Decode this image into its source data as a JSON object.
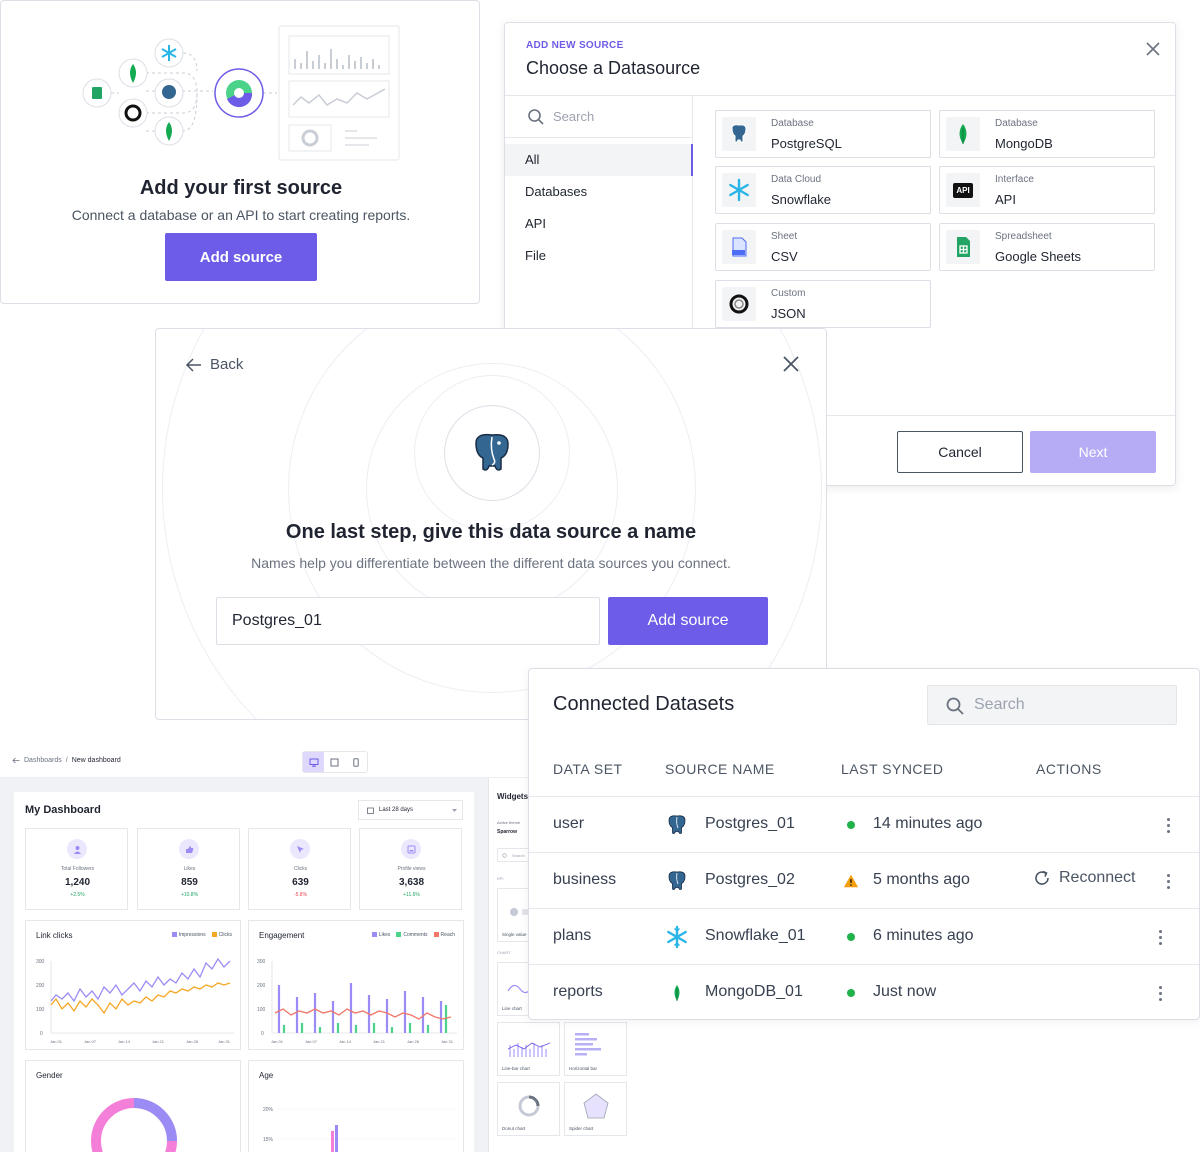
{
  "first_source": {
    "title": "Add your first source",
    "subtitle": "Connect a database or an API to start creating reports.",
    "button": "Add source"
  },
  "choose": {
    "eyebrow": "ADD NEW SOURCE",
    "title": "Choose a Datasource",
    "search_placeholder": "Search",
    "categories": [
      {
        "label": "All",
        "active": true
      },
      {
        "label": "Databases",
        "active": false
      },
      {
        "label": "API",
        "active": false
      },
      {
        "label": "File",
        "active": false
      }
    ],
    "sources": [
      {
        "kind": "Database",
        "name": "PostgreSQL",
        "icon": "postgres-icon"
      },
      {
        "kind": "Database",
        "name": "MongoDB",
        "icon": "mongodb-icon"
      },
      {
        "kind": "Data Cloud",
        "name": "Snowflake",
        "icon": "snowflake-icon"
      },
      {
        "kind": "Interface",
        "name": "API",
        "icon": "api-icon"
      },
      {
        "kind": "Sheet",
        "name": "CSV",
        "icon": "csv-icon"
      },
      {
        "kind": "Spreadsheet",
        "name": "Google Sheets",
        "icon": "google-sheets-icon"
      },
      {
        "kind": "Custom",
        "name": "JSON",
        "icon": "json-icon"
      }
    ],
    "api_badge": "API",
    "cancel": "Cancel",
    "next": "Next"
  },
  "name_step": {
    "back": "Back",
    "title": "One last step, give this data source a name",
    "subtitle": "Names help you differentiate between the different data sources you connect.",
    "input_value": "Postgres_01",
    "button": "Add source"
  },
  "dashboard": {
    "breadcrumb_root": "Dashboards",
    "breadcrumb_current": "New dashboard",
    "title": "My Dashboard",
    "date_range": "Last 28 days",
    "kpis": [
      {
        "label": "Total Followers",
        "value": "1,240",
        "delta": "+2.5%",
        "up": true
      },
      {
        "label": "Likes",
        "value": "859",
        "delta": "+10.8%",
        "up": true
      },
      {
        "label": "Clicks",
        "value": "639",
        "delta": "-5.8%",
        "up": false
      },
      {
        "label": "Profile views",
        "value": "3,638",
        "delta": "+11.6%",
        "up": true
      }
    ],
    "link_clicks": {
      "title": "Link clicks",
      "legend": [
        "Impressions",
        "Clicks"
      ],
      "yticks": [
        "300",
        "200",
        "100",
        "0"
      ],
      "xticks": [
        "Jan 01",
        "Jan 07",
        "Jan 14",
        "Jan 21",
        "Jan 28",
        "Jan 31"
      ]
    },
    "engagement": {
      "title": "Engagement",
      "legend": [
        "Likes",
        "Comments",
        "Reach"
      ],
      "yticks": [
        "300",
        "200",
        "100",
        "0"
      ],
      "xticks": [
        "Jan 01",
        "Jan 07",
        "Jan 14",
        "Jan 21",
        "Jan 28",
        "Jan 31"
      ]
    },
    "gender_title": "Gender",
    "age": {
      "title": "Age",
      "yticks": [
        "20%",
        "15%"
      ]
    },
    "colors": {
      "impressions": "#9b8cf5",
      "clicks": "#f5a623",
      "comments": "#4cd38a",
      "reach": "#f0776a",
      "accent": "#6c5ce7"
    },
    "widgets": {
      "title": "Widgets",
      "active_theme_label": "Active theme",
      "active_theme": "Sparrow",
      "search_placeholder": "Search",
      "section_kpi": "KPI",
      "section_chart": "CHART",
      "tiles": [
        "Single value",
        "Line chart",
        "Line-bar chart",
        "Horizontal bar",
        "Donut chart",
        "Spider chart"
      ]
    }
  },
  "datasets": {
    "title": "Connected Datasets",
    "search_placeholder": "Search",
    "columns": [
      "DATA SET",
      "SOURCE NAME",
      "LAST SYNCED",
      "ACTIONS"
    ],
    "rows": [
      {
        "dataset": "user",
        "source": "Postgres_01",
        "source_icon": "postgres-icon",
        "synced": "14 minutes ago",
        "status": "ok",
        "action": ""
      },
      {
        "dataset": "business",
        "source": "Postgres_02",
        "source_icon": "postgres-icon",
        "synced": "5 months ago",
        "status": "warning",
        "action": "Reconnect"
      },
      {
        "dataset": "plans",
        "source": "Snowflake_01",
        "source_icon": "snowflake-icon",
        "synced": "6 minutes ago",
        "status": "ok",
        "action": ""
      },
      {
        "dataset": "reports",
        "source": "MongoDB_01",
        "source_icon": "mongodb-icon",
        "synced": "Just now",
        "status": "ok",
        "action": ""
      }
    ]
  }
}
